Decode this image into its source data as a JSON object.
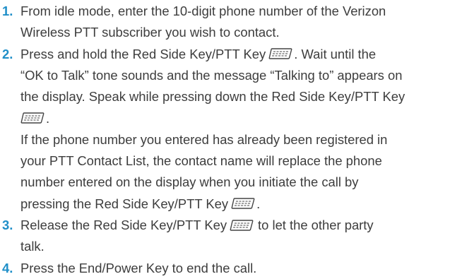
{
  "steps": [
    {
      "number": "1.",
      "lines": [
        "From idle mode, enter the 10-digit phone number of the Verizon",
        "Wireless PTT subscriber you wish to contact."
      ]
    },
    {
      "number": "2.",
      "lines": [
        "Press and hold the Red Side Key/PTT Key",
        ". Wait until the",
        "“OK to Talk” tone sounds and the message “Talking to” appears on",
        "the display. Speak while pressing down the Red Side Key/PTT Key",
        "."
      ],
      "note_lines": [
        "If the phone number you entered has already been registered in",
        "your PTT Contact List, the contact name will replace the phone",
        "number entered on the display when you initiate the call by",
        "pressing the Red Side Key/PTT Key",
        "."
      ]
    },
    {
      "number": "3.",
      "lines": [
        "Release the Red Side Key/PTT Key",
        "to let the other party",
        "talk."
      ]
    },
    {
      "number": "4.",
      "lines": [
        "Press the End/Power Key to end the call."
      ]
    }
  ],
  "icons": {
    "ptt_key": "ptt-key-icon"
  }
}
